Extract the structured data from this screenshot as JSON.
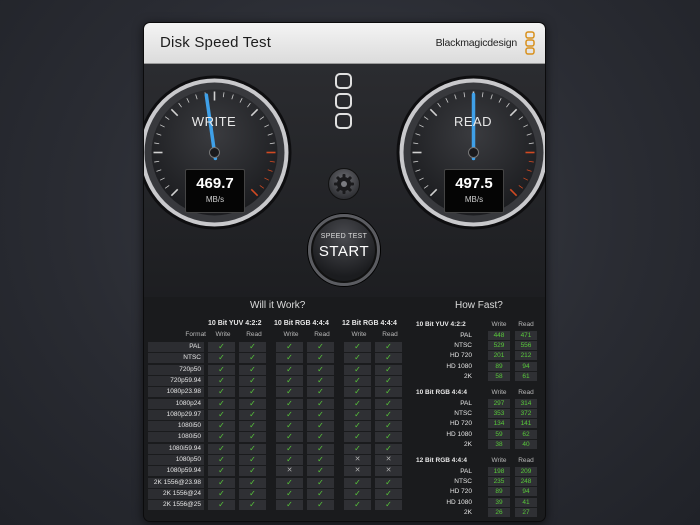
{
  "window": {
    "title": "Disk Speed Test",
    "brand": "Blackmagicdesign"
  },
  "gauges": {
    "write": {
      "label": "WRITE",
      "value": "469.7",
      "unit": "MB/s",
      "needle_fraction": 0.47
    },
    "read": {
      "label": "READ",
      "value": "497.5",
      "unit": "MB/s",
      "needle_fraction": 0.5
    }
  },
  "start_button": {
    "small": "SPEED TEST",
    "big": "START"
  },
  "will_it_work": {
    "title": "Will it Work?",
    "format_header": "Format",
    "groups": [
      {
        "name": "10 Bit YUV 4:2:2",
        "cols": [
          "Write",
          "Read"
        ]
      },
      {
        "name": "10 Bit RGB 4:4:4",
        "cols": [
          "Write",
          "Read"
        ]
      },
      {
        "name": "12 Bit RGB 4:4:4",
        "cols": [
          "Write",
          "Read"
        ]
      }
    ],
    "rows": [
      {
        "format": "PAL",
        "marks": [
          "ok",
          "ok",
          "ok",
          "ok",
          "ok",
          "ok"
        ]
      },
      {
        "format": "NTSC",
        "marks": [
          "ok",
          "ok",
          "ok",
          "ok",
          "ok",
          "ok"
        ]
      },
      {
        "format": "720p50",
        "marks": [
          "ok",
          "ok",
          "ok",
          "ok",
          "ok",
          "ok"
        ]
      },
      {
        "format": "720p59.94",
        "marks": [
          "ok",
          "ok",
          "ok",
          "ok",
          "ok",
          "ok"
        ]
      },
      {
        "format": "1080p23.98",
        "marks": [
          "ok",
          "ok",
          "ok",
          "ok",
          "ok",
          "ok"
        ]
      },
      {
        "format": "1080p24",
        "marks": [
          "ok",
          "ok",
          "ok",
          "ok",
          "ok",
          "ok"
        ]
      },
      {
        "format": "1080p29.97",
        "marks": [
          "ok",
          "ok",
          "ok",
          "ok",
          "ok",
          "ok"
        ]
      },
      {
        "format": "1080i50",
        "marks": [
          "ok",
          "ok",
          "ok",
          "ok",
          "ok",
          "ok"
        ]
      },
      {
        "format": "1080i50",
        "marks": [
          "ok",
          "ok",
          "ok",
          "ok",
          "ok",
          "ok"
        ]
      },
      {
        "format": "1080i59.94",
        "marks": [
          "ok",
          "ok",
          "ok",
          "ok",
          "ok",
          "ok"
        ]
      },
      {
        "format": "1080p50",
        "marks": [
          "ok",
          "ok",
          "ok",
          "ok",
          "no",
          "no"
        ]
      },
      {
        "format": "1080p59.94",
        "marks": [
          "ok",
          "ok",
          "no",
          "ok",
          "no",
          "no"
        ]
      },
      {
        "format": "2K 1556@23.98",
        "marks": [
          "ok",
          "ok",
          "ok",
          "ok",
          "ok",
          "ok"
        ]
      },
      {
        "format": "2K 1556@24",
        "marks": [
          "ok",
          "ok",
          "ok",
          "ok",
          "ok",
          "ok"
        ]
      },
      {
        "format": "2K 1556@25",
        "marks": [
          "ok",
          "ok",
          "ok",
          "ok",
          "ok",
          "ok"
        ]
      }
    ]
  },
  "how_fast": {
    "title": "How Fast?",
    "groups": [
      {
        "name": "10 Bit YUV 4:2:2",
        "cols": [
          "Write",
          "Read"
        ],
        "rows": [
          {
            "label": "PAL",
            "write": "448",
            "read": "471"
          },
          {
            "label": "NTSC",
            "write": "529",
            "read": "556"
          },
          {
            "label": "HD 720",
            "write": "201",
            "read": "212"
          },
          {
            "label": "HD 1080",
            "write": "89",
            "read": "94"
          },
          {
            "label": "2K",
            "write": "58",
            "read": "61"
          }
        ]
      },
      {
        "name": "10 Bit RGB 4:4:4",
        "cols": [
          "Write",
          "Read"
        ],
        "rows": [
          {
            "label": "PAL",
            "write": "297",
            "read": "314"
          },
          {
            "label": "NTSC",
            "write": "353",
            "read": "372"
          },
          {
            "label": "HD 720",
            "write": "134",
            "read": "141"
          },
          {
            "label": "HD 1080",
            "write": "59",
            "read": "62"
          },
          {
            "label": "2K",
            "write": "38",
            "read": "40"
          }
        ]
      },
      {
        "name": "12 Bit RGB 4:4:4",
        "cols": [
          "Write",
          "Read"
        ],
        "rows": [
          {
            "label": "PAL",
            "write": "198",
            "read": "209"
          },
          {
            "label": "NTSC",
            "write": "235",
            "read": "248"
          },
          {
            "label": "HD 720",
            "write": "89",
            "read": "94"
          },
          {
            "label": "HD 1080",
            "write": "39",
            "read": "41"
          },
          {
            "label": "2K",
            "write": "26",
            "read": "27"
          }
        ]
      }
    ]
  },
  "icons": {
    "settings": "gear-icon",
    "brand_logo": "blackmagic-logo-icon",
    "app_logo": "disk-speed-logo-icon"
  },
  "colors": {
    "ok_mark": "#58c93a",
    "needle": "#3fa0e8",
    "redline": "#d24a22"
  }
}
